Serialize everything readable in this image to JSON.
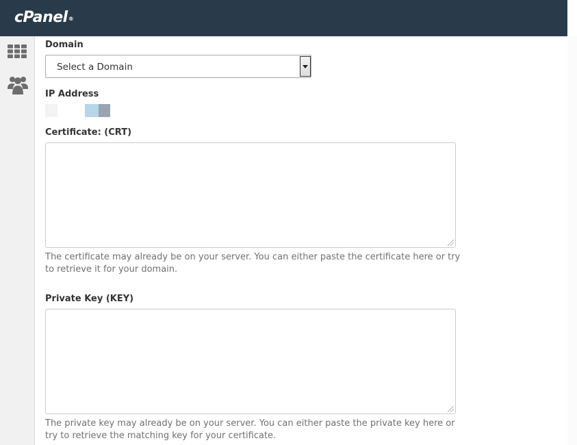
{
  "brand": {
    "logo_text": "cPanel",
    "logo_mark": "®"
  },
  "sidebar": {
    "items": [
      {
        "icon": "grid-icon",
        "label": ""
      },
      {
        "icon": "users-icon",
        "label": ""
      }
    ]
  },
  "form": {
    "domain": {
      "label": "Domain",
      "selected": "Select a Domain"
    },
    "ip_address": {
      "label": "IP Address",
      "value_colors": [
        "#f3f3f3",
        "#b7d6ea",
        "#9aa4b1"
      ]
    },
    "certificate": {
      "label": "Certificate: (CRT)",
      "value": "",
      "help": "The certificate may already be on your server. You can either paste the certificate here or try to retrieve it for your domain."
    },
    "private_key": {
      "label": "Private Key (KEY)",
      "value": "",
      "help": "The private key may already be on your server. You can either paste the private key here or try to retrieve the matching key for your certificate."
    }
  },
  "colors": {
    "topbar": "#293a4a",
    "sidebar": "#f1f1f1",
    "icon": "#6d6d6d"
  }
}
